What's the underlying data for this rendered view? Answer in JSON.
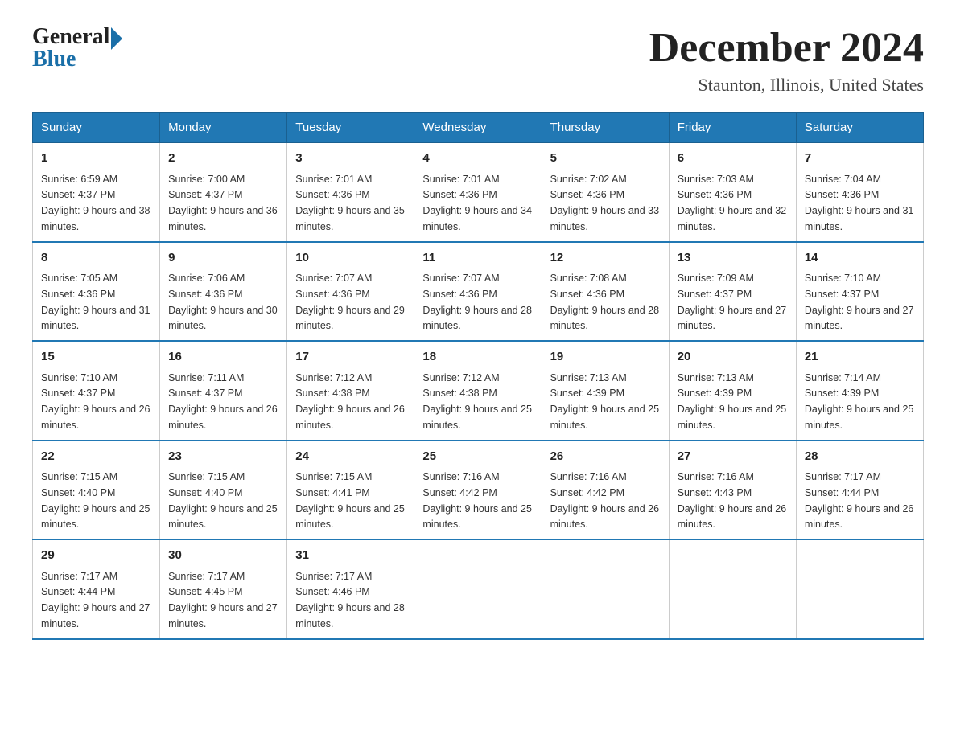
{
  "logo": {
    "general_text": "General",
    "blue_text": "Blue"
  },
  "title": "December 2024",
  "location": "Staunton, Illinois, United States",
  "weekdays": [
    "Sunday",
    "Monday",
    "Tuesday",
    "Wednesday",
    "Thursday",
    "Friday",
    "Saturday"
  ],
  "weeks": [
    [
      {
        "day": "1",
        "sunrise": "Sunrise: 6:59 AM",
        "sunset": "Sunset: 4:37 PM",
        "daylight": "Daylight: 9 hours and 38 minutes."
      },
      {
        "day": "2",
        "sunrise": "Sunrise: 7:00 AM",
        "sunset": "Sunset: 4:37 PM",
        "daylight": "Daylight: 9 hours and 36 minutes."
      },
      {
        "day": "3",
        "sunrise": "Sunrise: 7:01 AM",
        "sunset": "Sunset: 4:36 PM",
        "daylight": "Daylight: 9 hours and 35 minutes."
      },
      {
        "day": "4",
        "sunrise": "Sunrise: 7:01 AM",
        "sunset": "Sunset: 4:36 PM",
        "daylight": "Daylight: 9 hours and 34 minutes."
      },
      {
        "day": "5",
        "sunrise": "Sunrise: 7:02 AM",
        "sunset": "Sunset: 4:36 PM",
        "daylight": "Daylight: 9 hours and 33 minutes."
      },
      {
        "day": "6",
        "sunrise": "Sunrise: 7:03 AM",
        "sunset": "Sunset: 4:36 PM",
        "daylight": "Daylight: 9 hours and 32 minutes."
      },
      {
        "day": "7",
        "sunrise": "Sunrise: 7:04 AM",
        "sunset": "Sunset: 4:36 PM",
        "daylight": "Daylight: 9 hours and 31 minutes."
      }
    ],
    [
      {
        "day": "8",
        "sunrise": "Sunrise: 7:05 AM",
        "sunset": "Sunset: 4:36 PM",
        "daylight": "Daylight: 9 hours and 31 minutes."
      },
      {
        "day": "9",
        "sunrise": "Sunrise: 7:06 AM",
        "sunset": "Sunset: 4:36 PM",
        "daylight": "Daylight: 9 hours and 30 minutes."
      },
      {
        "day": "10",
        "sunrise": "Sunrise: 7:07 AM",
        "sunset": "Sunset: 4:36 PM",
        "daylight": "Daylight: 9 hours and 29 minutes."
      },
      {
        "day": "11",
        "sunrise": "Sunrise: 7:07 AM",
        "sunset": "Sunset: 4:36 PM",
        "daylight": "Daylight: 9 hours and 28 minutes."
      },
      {
        "day": "12",
        "sunrise": "Sunrise: 7:08 AM",
        "sunset": "Sunset: 4:36 PM",
        "daylight": "Daylight: 9 hours and 28 minutes."
      },
      {
        "day": "13",
        "sunrise": "Sunrise: 7:09 AM",
        "sunset": "Sunset: 4:37 PM",
        "daylight": "Daylight: 9 hours and 27 minutes."
      },
      {
        "day": "14",
        "sunrise": "Sunrise: 7:10 AM",
        "sunset": "Sunset: 4:37 PM",
        "daylight": "Daylight: 9 hours and 27 minutes."
      }
    ],
    [
      {
        "day": "15",
        "sunrise": "Sunrise: 7:10 AM",
        "sunset": "Sunset: 4:37 PM",
        "daylight": "Daylight: 9 hours and 26 minutes."
      },
      {
        "day": "16",
        "sunrise": "Sunrise: 7:11 AM",
        "sunset": "Sunset: 4:37 PM",
        "daylight": "Daylight: 9 hours and 26 minutes."
      },
      {
        "day": "17",
        "sunrise": "Sunrise: 7:12 AM",
        "sunset": "Sunset: 4:38 PM",
        "daylight": "Daylight: 9 hours and 26 minutes."
      },
      {
        "day": "18",
        "sunrise": "Sunrise: 7:12 AM",
        "sunset": "Sunset: 4:38 PM",
        "daylight": "Daylight: 9 hours and 25 minutes."
      },
      {
        "day": "19",
        "sunrise": "Sunrise: 7:13 AM",
        "sunset": "Sunset: 4:39 PM",
        "daylight": "Daylight: 9 hours and 25 minutes."
      },
      {
        "day": "20",
        "sunrise": "Sunrise: 7:13 AM",
        "sunset": "Sunset: 4:39 PM",
        "daylight": "Daylight: 9 hours and 25 minutes."
      },
      {
        "day": "21",
        "sunrise": "Sunrise: 7:14 AM",
        "sunset": "Sunset: 4:39 PM",
        "daylight": "Daylight: 9 hours and 25 minutes."
      }
    ],
    [
      {
        "day": "22",
        "sunrise": "Sunrise: 7:15 AM",
        "sunset": "Sunset: 4:40 PM",
        "daylight": "Daylight: 9 hours and 25 minutes."
      },
      {
        "day": "23",
        "sunrise": "Sunrise: 7:15 AM",
        "sunset": "Sunset: 4:40 PM",
        "daylight": "Daylight: 9 hours and 25 minutes."
      },
      {
        "day": "24",
        "sunrise": "Sunrise: 7:15 AM",
        "sunset": "Sunset: 4:41 PM",
        "daylight": "Daylight: 9 hours and 25 minutes."
      },
      {
        "day": "25",
        "sunrise": "Sunrise: 7:16 AM",
        "sunset": "Sunset: 4:42 PM",
        "daylight": "Daylight: 9 hours and 25 minutes."
      },
      {
        "day": "26",
        "sunrise": "Sunrise: 7:16 AM",
        "sunset": "Sunset: 4:42 PM",
        "daylight": "Daylight: 9 hours and 26 minutes."
      },
      {
        "day": "27",
        "sunrise": "Sunrise: 7:16 AM",
        "sunset": "Sunset: 4:43 PM",
        "daylight": "Daylight: 9 hours and 26 minutes."
      },
      {
        "day": "28",
        "sunrise": "Sunrise: 7:17 AM",
        "sunset": "Sunset: 4:44 PM",
        "daylight": "Daylight: 9 hours and 26 minutes."
      }
    ],
    [
      {
        "day": "29",
        "sunrise": "Sunrise: 7:17 AM",
        "sunset": "Sunset: 4:44 PM",
        "daylight": "Daylight: 9 hours and 27 minutes."
      },
      {
        "day": "30",
        "sunrise": "Sunrise: 7:17 AM",
        "sunset": "Sunset: 4:45 PM",
        "daylight": "Daylight: 9 hours and 27 minutes."
      },
      {
        "day": "31",
        "sunrise": "Sunrise: 7:17 AM",
        "sunset": "Sunset: 4:46 PM",
        "daylight": "Daylight: 9 hours and 28 minutes."
      },
      null,
      null,
      null,
      null
    ]
  ]
}
